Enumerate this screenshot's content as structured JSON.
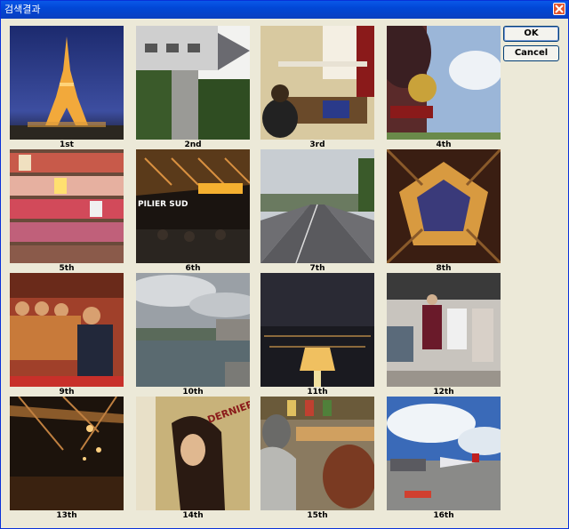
{
  "window": {
    "title": "검색결과",
    "ok_label": "OK",
    "cancel_label": "Cancel"
  },
  "results": [
    {
      "caption": "1st",
      "icon": "eiffel-tower-night-photo"
    },
    {
      "caption": "2nd",
      "icon": "chateau-rotated-photo"
    },
    {
      "caption": "3rd",
      "icon": "hostel-room-photo"
    },
    {
      "caption": "4th",
      "icon": "heraldic-sign-photo"
    },
    {
      "caption": "5th",
      "icon": "magazine-rack-photo"
    },
    {
      "caption": "6th",
      "icon": "pilier-sud-photo"
    },
    {
      "caption": "7th",
      "icon": "boulevard-photo"
    },
    {
      "caption": "8th",
      "icon": "tower-underside-photo"
    },
    {
      "caption": "9th",
      "icon": "monks-seated-photo"
    },
    {
      "caption": "10th",
      "icon": "river-cloudy-photo"
    },
    {
      "caption": "11th",
      "icon": "city-night-view-photo"
    },
    {
      "caption": "12th",
      "icon": "clothing-store-photo"
    },
    {
      "caption": "13th",
      "icon": "tower-structure-photo"
    },
    {
      "caption": "14th",
      "icon": "poster-photo"
    },
    {
      "caption": "15th",
      "icon": "market-stall-photo"
    },
    {
      "caption": "16th",
      "icon": "airport-photo"
    }
  ],
  "photo_texts": {
    "pilier_sud": "PILIER SUD",
    "poster": "DERNIERS JO"
  }
}
